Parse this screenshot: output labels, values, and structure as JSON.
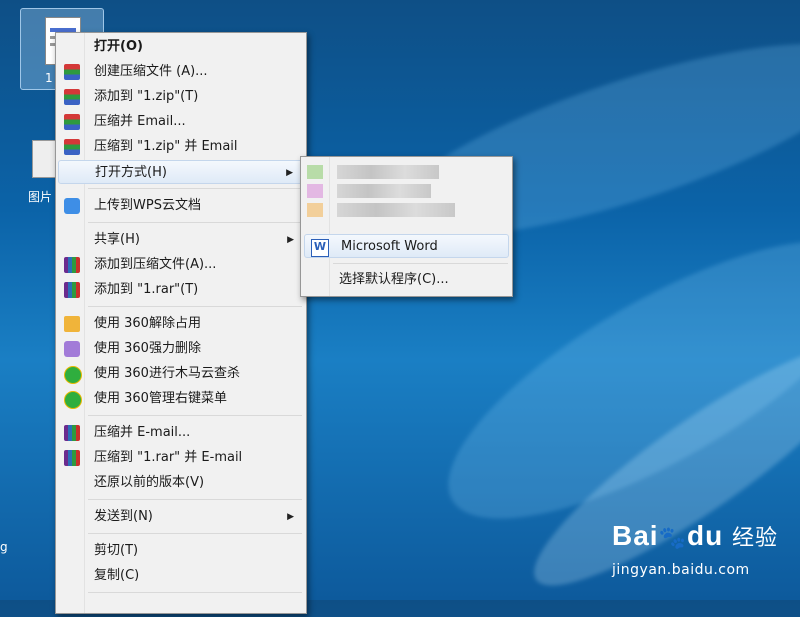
{
  "desktop": {
    "icon1_label": "1",
    "icon2_label": "图片",
    "icon3_label": "g"
  },
  "context_menu": {
    "items": [
      {
        "label": "打开(O)"
      },
      {
        "label": "创建压缩文件 (A)..."
      },
      {
        "label": "添加到 \"1.zip\"(T)"
      },
      {
        "label": "压缩并 Email..."
      },
      {
        "label": "压缩到 \"1.zip\" 并 Email"
      },
      {
        "label": "打开方式(H)"
      },
      {
        "label": "上传到WPS云文档"
      },
      {
        "label": "共享(H)"
      },
      {
        "label": "添加到压缩文件(A)..."
      },
      {
        "label": "添加到 \"1.rar\"(T)"
      },
      {
        "label": "使用 360解除占用"
      },
      {
        "label": "使用 360强力删除"
      },
      {
        "label": "使用 360进行木马云查杀"
      },
      {
        "label": "使用 360管理右键菜单"
      },
      {
        "label": "压缩并 E-mail..."
      },
      {
        "label": "压缩到 \"1.rar\" 并 E-mail"
      },
      {
        "label": "还原以前的版本(V)"
      },
      {
        "label": "发送到(N)"
      },
      {
        "label": "剪切(T)"
      },
      {
        "label": "复制(C)"
      }
    ]
  },
  "submenu": {
    "word_label": "Microsoft Word",
    "default_program_label": "选择默认程序(C)..."
  },
  "watermark": {
    "brand_left": "Bai",
    "brand_mid": "du",
    "brand_right": "经验",
    "url": "jingyan.baidu.com"
  }
}
